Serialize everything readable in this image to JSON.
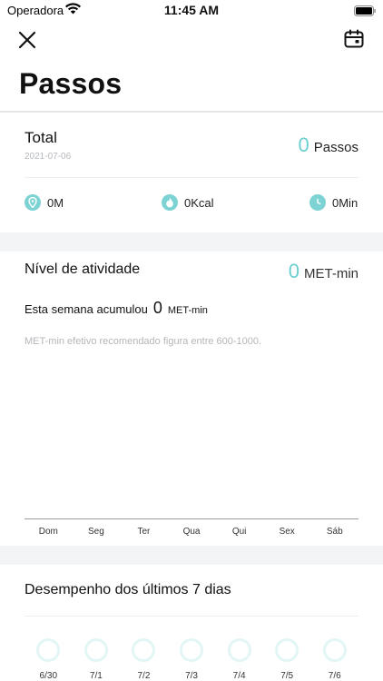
{
  "status_bar": {
    "carrier": "Operadora",
    "time": "11:45 AM"
  },
  "header": {
    "title": "Passos"
  },
  "total": {
    "label": "Total",
    "date": "2021-07-06",
    "value": "0",
    "unit": "Passos",
    "stats": [
      {
        "icon": "location-pin-icon",
        "text": "0M"
      },
      {
        "icon": "flame-icon",
        "text": "0Kcal"
      },
      {
        "icon": "clock-icon",
        "text": "0Min"
      }
    ]
  },
  "activity": {
    "title": "Nível de atividade",
    "value": "0",
    "unit": "MET-min",
    "week_prefix": "Esta semana acumulou",
    "week_value": "0",
    "week_unit": "MET-min",
    "note": "MET-min efetivo recomendado figura entre 600-1000.",
    "days": [
      "Dom",
      "Seg",
      "Ter",
      "Qua",
      "Qui",
      "Sex",
      "Sáb"
    ]
  },
  "performance": {
    "title": "Desempenho dos últimos 7 dias",
    "dates": [
      "6/30",
      "7/1",
      "7/2",
      "7/3",
      "7/4",
      "7/5",
      "7/6"
    ]
  },
  "colors": {
    "accent": "#6ccfcf",
    "icon_bg": "#7dd3d3",
    "band": "#f3f4f6"
  }
}
